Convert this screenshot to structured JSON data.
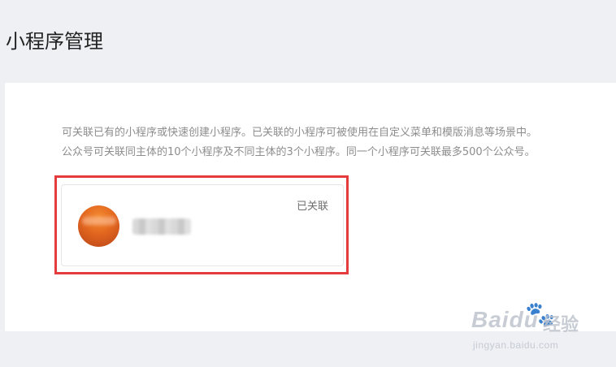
{
  "page": {
    "title": "小程序管理"
  },
  "description": {
    "line1": "可关联已有的小程序或快速创建小程序。已关联的小程序可被使用在自定义菜单和模版消息等场景中。",
    "line2": "公众号可关联同主体的10个小程序及不同主体的3个小程序。同一个小程序可关联最多500个公众号。"
  },
  "mini_program_card": {
    "status": "已关联",
    "name": ""
  },
  "watermark": {
    "brand": "Bai",
    "brand_suffix": "du",
    "sub": "经验",
    "url": "jingyan.baidu.com"
  },
  "colors": {
    "highlight_border": "#e43c3c",
    "avatar_orange": "#e2661e",
    "page_background": "#eef0f4"
  }
}
